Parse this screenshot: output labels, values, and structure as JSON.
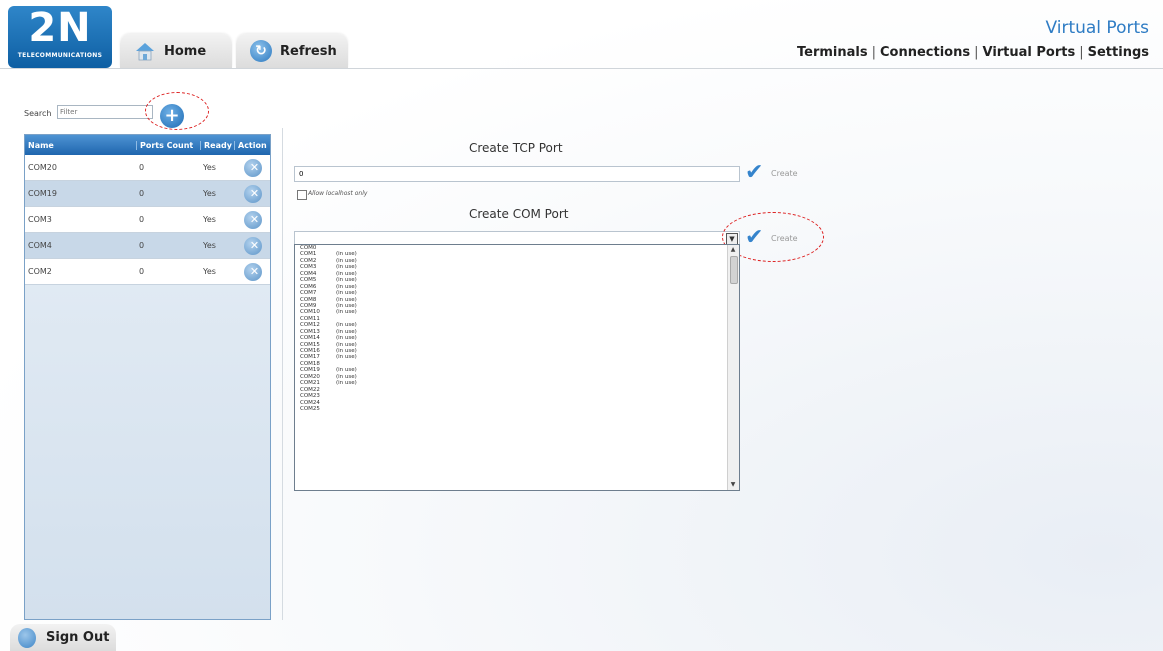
{
  "logo": {
    "big": "2N",
    "small": "TELECOMMUNICATIONS"
  },
  "nav": {
    "home": "Home",
    "refresh": "Refresh"
  },
  "page_title": "Virtual Ports",
  "toplinks": {
    "terminals": "Terminals",
    "connections": "Connections",
    "virtual_ports": "Virtual Ports",
    "settings": "Settings",
    "separator": "|"
  },
  "search": {
    "label": "Search",
    "placeholder": "Filter",
    "add_symbol": "+"
  },
  "table": {
    "headers": {
      "name": "Name",
      "ports_count": "Ports Count",
      "ready": "Ready",
      "action": "Action"
    },
    "rows": [
      {
        "name": "COM20",
        "ports_count": "0",
        "ready": "Yes"
      },
      {
        "name": "COM19",
        "ports_count": "0",
        "ready": "Yes"
      },
      {
        "name": "COM3",
        "ports_count": "0",
        "ready": "Yes"
      },
      {
        "name": "COM4",
        "ports_count": "0",
        "ready": "Yes"
      },
      {
        "name": "COM2",
        "ports_count": "0",
        "ready": "Yes"
      }
    ],
    "delete_symbol": "✕"
  },
  "tcp": {
    "title": "Create TCP Port",
    "value": "0",
    "create_label": "Create",
    "localhost_label": "Allow localhost only"
  },
  "com": {
    "title": "Create COM Port",
    "create_label": "Create",
    "ports": [
      {
        "name": "COM0",
        "status": ""
      },
      {
        "name": "COM1",
        "status": "(in use)"
      },
      {
        "name": "COM2",
        "status": "(in use)"
      },
      {
        "name": "COM3",
        "status": "(in use)"
      },
      {
        "name": "COM4",
        "status": "(in use)"
      },
      {
        "name": "COM5",
        "status": "(in use)"
      },
      {
        "name": "COM6",
        "status": "(in use)"
      },
      {
        "name": "COM7",
        "status": "(in use)"
      },
      {
        "name": "COM8",
        "status": "(in use)"
      },
      {
        "name": "COM9",
        "status": "(in use)"
      },
      {
        "name": "COM10",
        "status": "(in use)"
      },
      {
        "name": "COM11",
        "status": ""
      },
      {
        "name": "COM12",
        "status": "(in use)"
      },
      {
        "name": "COM13",
        "status": "(in use)"
      },
      {
        "name": "COM14",
        "status": "(in use)"
      },
      {
        "name": "COM15",
        "status": "(in use)"
      },
      {
        "name": "COM16",
        "status": "(in use)"
      },
      {
        "name": "COM17",
        "status": "(in use)"
      },
      {
        "name": "COM18",
        "status": ""
      },
      {
        "name": "COM19",
        "status": "(in use)"
      },
      {
        "name": "COM20",
        "status": "(in use)"
      },
      {
        "name": "COM21",
        "status": "(in use)"
      },
      {
        "name": "COM22",
        "status": ""
      },
      {
        "name": "COM23",
        "status": ""
      },
      {
        "name": "COM24",
        "status": ""
      },
      {
        "name": "COM25",
        "status": ""
      }
    ]
  },
  "signout": "Sign Out",
  "colors": {
    "accent": "#2e7cc4",
    "header_blue": "#1f66ae",
    "highlight": "#d22222"
  }
}
